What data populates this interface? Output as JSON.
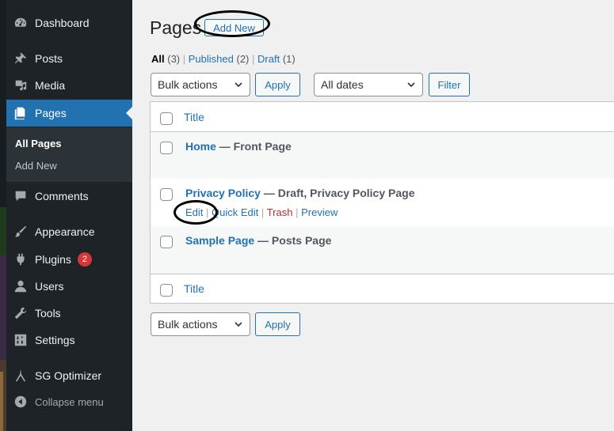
{
  "sidebar": {
    "items": [
      {
        "label": "Dashboard",
        "icon": "dashboard-icon"
      },
      {
        "label": "Posts",
        "icon": "pin-icon"
      },
      {
        "label": "Media",
        "icon": "media-icon"
      },
      {
        "label": "Pages",
        "icon": "pages-icon",
        "current": true
      },
      {
        "label": "Comments",
        "icon": "comment-icon"
      },
      {
        "label": "Appearance",
        "icon": "brush-icon"
      },
      {
        "label": "Plugins",
        "icon": "plugin-icon",
        "badge": "2"
      },
      {
        "label": "Users",
        "icon": "user-icon"
      },
      {
        "label": "Tools",
        "icon": "wrench-icon"
      },
      {
        "label": "Settings",
        "icon": "settings-icon"
      },
      {
        "label": "SG Optimizer",
        "icon": "sg-icon"
      }
    ],
    "submenu": [
      "All Pages",
      "Add New"
    ],
    "collapse_label": "Collapse menu"
  },
  "header": {
    "title": "Pages",
    "add_new": "Add New"
  },
  "filters": {
    "all": "All",
    "all_count": "(3)",
    "published": "Published",
    "published_count": "(2)",
    "draft": "Draft",
    "draft_count": "(1)"
  },
  "toolbar": {
    "bulk_actions": "Bulk actions",
    "apply": "Apply",
    "dates": "All dates",
    "filter": "Filter"
  },
  "table": {
    "column_title": "Title",
    "rows": [
      {
        "title": "Home",
        "state": " — Front Page"
      },
      {
        "title": "Privacy Policy",
        "state": " — Draft, Privacy Policy Page",
        "actions": {
          "edit": "Edit",
          "quick_edit": "Quick Edit",
          "trash": "Trash",
          "preview": "Preview",
          "sep": "|"
        }
      },
      {
        "title": "Sample Page",
        "state": " — Posts Page"
      }
    ]
  },
  "colors": {
    "accent": "#2271b1",
    "sidebar_bg": "#1d2327",
    "badge": "#d63638",
    "trash": "#b32d2e"
  }
}
